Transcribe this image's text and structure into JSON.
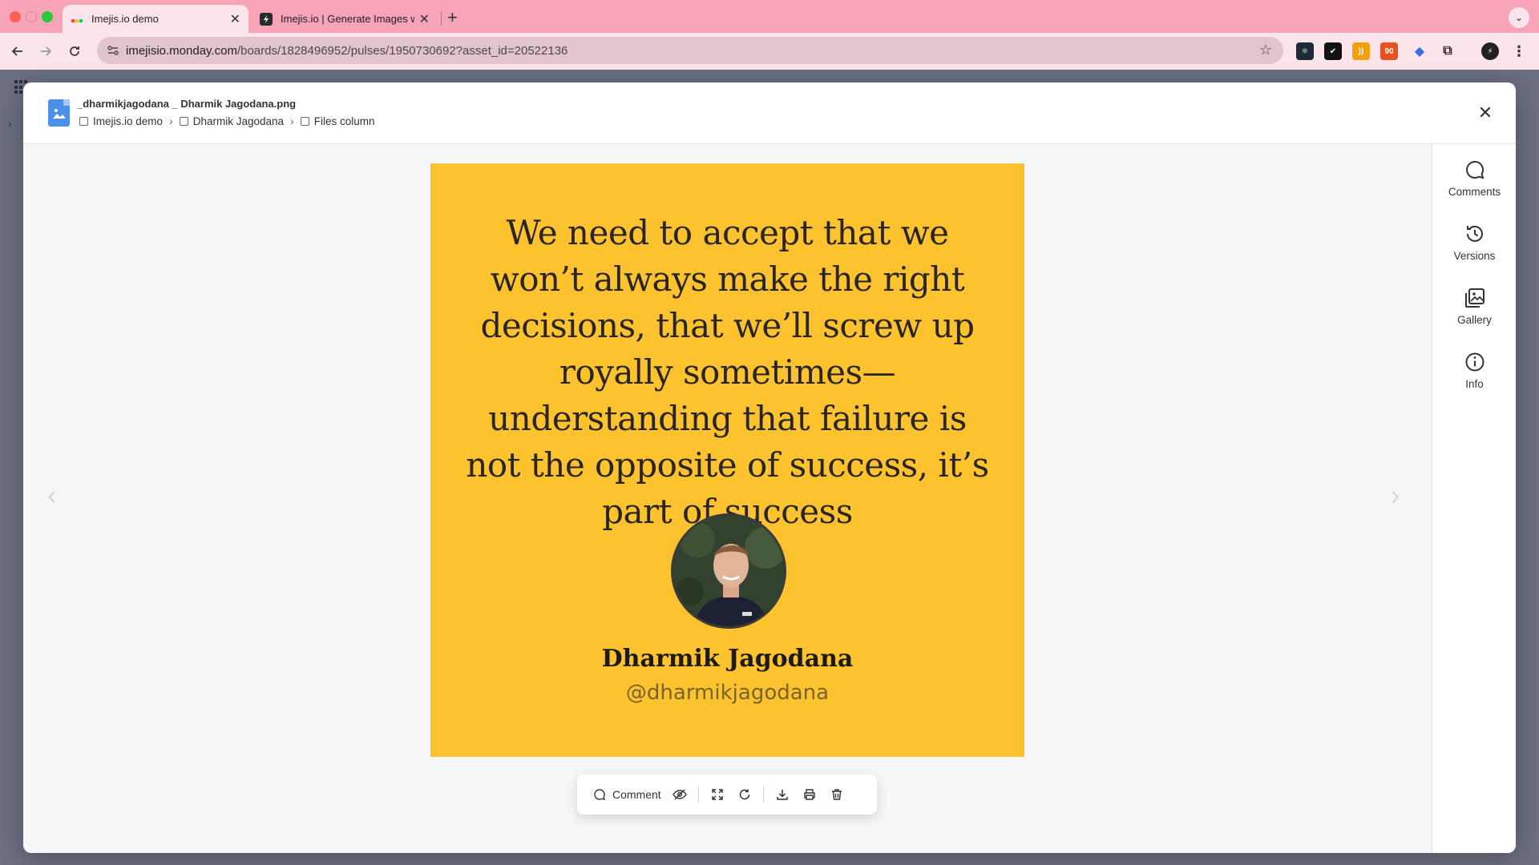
{
  "browser": {
    "tabs": [
      {
        "title": "Imejis.io demo",
        "active": true
      },
      {
        "title": "Imejis.io | Generate Images w",
        "active": false
      }
    ],
    "url_host": "imejisio.monday.com",
    "url_path": "/boards/1828496952/pulses/1950730692?asset_id=20522136",
    "extension_badge": "90"
  },
  "modal": {
    "file_name": "_dharmikjagodana _ Dharmik Jagodana.png",
    "breadcrumb": [
      "Imejis.io demo",
      "Dharmik Jagodana",
      "Files column"
    ]
  },
  "image": {
    "quote": "We need to accept that we won’t always make the right decisions, that we’ll screw up royally sometimes—understanding that failure is not the opposite of success, it’s part of success",
    "name": "Dharmik Jagodana",
    "handle": "@dharmikjagodana",
    "background_color": "#fdc32f"
  },
  "toolbar": {
    "comment_label": "Comment"
  },
  "side_panel": {
    "items": [
      {
        "label": "Comments",
        "icon": "comment-icon"
      },
      {
        "label": "Versions",
        "icon": "history-icon"
      },
      {
        "label": "Gallery",
        "icon": "gallery-icon"
      },
      {
        "label": "Info",
        "icon": "info-icon"
      }
    ]
  },
  "colors": {
    "tab_bar": "#f8a4b8",
    "accent_file": "#4d8fe8"
  }
}
